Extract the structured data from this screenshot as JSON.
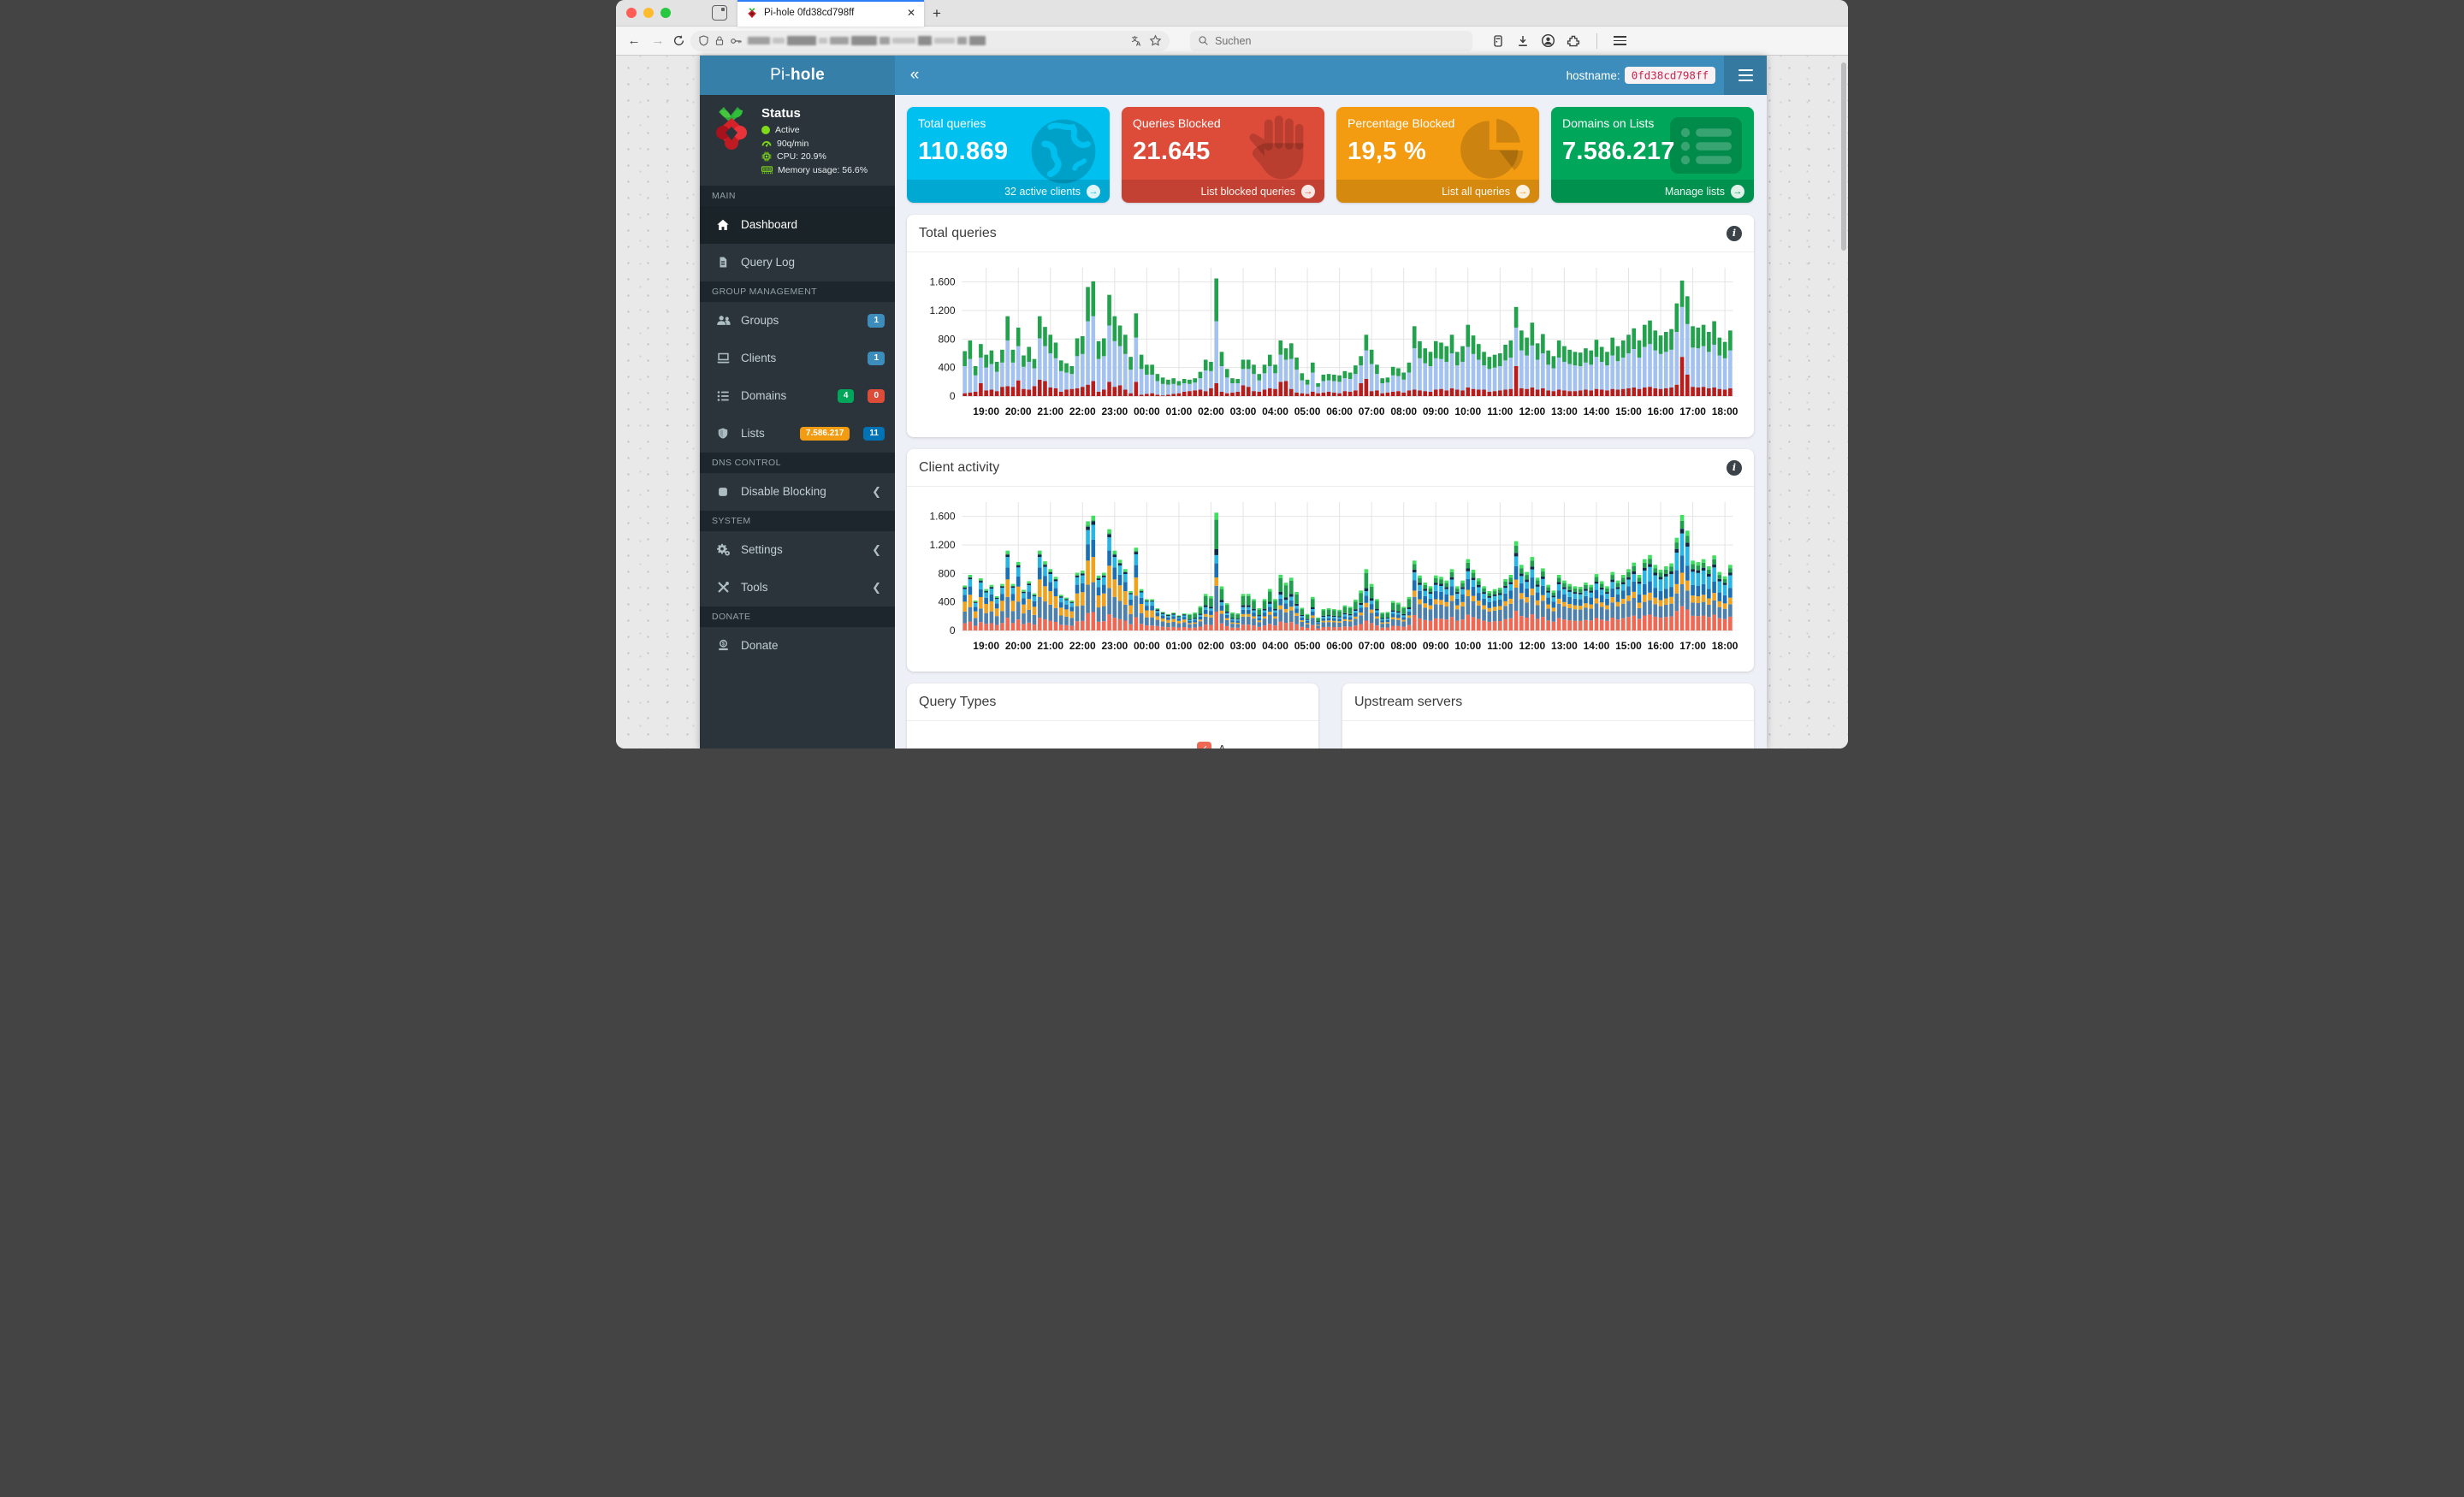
{
  "browser": {
    "tab_title": "Pi-hole 0fd38cd798ff",
    "new_tab_label": "+",
    "close_label": "✕",
    "search_placeholder": "Suchen"
  },
  "header": {
    "brand_pre": "Pi-",
    "brand_bold": "hole",
    "collapse_glyph": "«",
    "hostname_label": "hostname:",
    "hostname_value": "0fd38cd798ff"
  },
  "status": {
    "title": "Status",
    "rows": [
      {
        "label": "Active"
      },
      {
        "label": "90q/min"
      },
      {
        "label": "CPU: 20.9%"
      },
      {
        "label": "Memory usage: 56.6%"
      }
    ]
  },
  "sidebar": {
    "sections": [
      {
        "label": "MAIN",
        "items": [
          {
            "label": "Dashboard"
          },
          {
            "label": "Query Log"
          }
        ]
      },
      {
        "label": "GROUP MANAGEMENT",
        "items": [
          {
            "label": "Groups",
            "badges": [
              {
                "text": "1",
                "color": "#3c8dbc"
              }
            ]
          },
          {
            "label": "Clients",
            "badges": [
              {
                "text": "1",
                "color": "#3c8dbc"
              }
            ]
          },
          {
            "label": "Domains",
            "badges": [
              {
                "text": "4",
                "color": "#00a65a"
              },
              {
                "text": "0",
                "color": "#dd4b39"
              }
            ]
          },
          {
            "label": "Lists",
            "badges": [
              {
                "text": "7.586.217",
                "color": "#f39c12"
              },
              {
                "text": "11",
                "color": "#0073b7"
              }
            ]
          }
        ]
      },
      {
        "label": "DNS CONTROL",
        "items": [
          {
            "label": "Disable Blocking",
            "chevron": "❮"
          }
        ]
      },
      {
        "label": "SYSTEM",
        "items": [
          {
            "label": "Settings",
            "chevron": "❮"
          },
          {
            "label": "Tools",
            "chevron": "❮"
          }
        ]
      },
      {
        "label": "DONATE",
        "items": [
          {
            "label": "Donate"
          }
        ]
      }
    ]
  },
  "cards": [
    {
      "title": "Total queries",
      "value": "110.869",
      "footer": "32 active clients",
      "color": "#00c0ef"
    },
    {
      "title": "Queries Blocked",
      "value": "21.645",
      "footer": "List blocked queries",
      "color": "#dd4b39"
    },
    {
      "title": "Percentage Blocked",
      "value": "19,5 %",
      "footer": "List all queries",
      "color": "#f39c12"
    },
    {
      "title": "Domains on Lists",
      "value": "7.586.217",
      "footer": "Manage lists",
      "color": "#00a65a"
    }
  ],
  "panels": {
    "total_queries": {
      "title": "Total queries"
    },
    "client_activity": {
      "title": "Client activity"
    },
    "query_types": {
      "title": "Query Types",
      "legend": [
        {
          "label": "A",
          "color": "#ee6853",
          "checked": true
        }
      ]
    },
    "upstream": {
      "title": "Upstream servers"
    }
  },
  "chart_data": [
    {
      "id": "total_queries",
      "type": "bar",
      "stacked": true,
      "title": "Total queries",
      "x_labels": [
        "19:00",
        "20:00",
        "21:00",
        "22:00",
        "23:00",
        "00:00",
        "01:00",
        "02:00",
        "03:00",
        "04:00",
        "05:00",
        "06:00",
        "07:00",
        "08:00",
        "09:00",
        "10:00",
        "11:00",
        "12:00",
        "13:00",
        "14:00",
        "15:00",
        "16:00",
        "17:00",
        "18:00"
      ],
      "ylim": [
        0,
        1800
      ],
      "yticks": [
        0,
        400,
        800,
        1200,
        1600
      ],
      "ytick_labels": [
        "0",
        "400",
        "800",
        "1.200",
        "1.600"
      ],
      "grid": true,
      "series": [
        {
          "name": "blocked",
          "color": "#b71d1d",
          "values": [
            40,
            50,
            60,
            180,
            80,
            90,
            70,
            130,
            140,
            130,
            220,
            100,
            90,
            140,
            230,
            210,
            120,
            110,
            60,
            90,
            100,
            110,
            130,
            160,
            210,
            60,
            90,
            200,
            130,
            150,
            90,
            40,
            200,
            20,
            30,
            40,
            20,
            10,
            20,
            30,
            40,
            60,
            70,
            80,
            90,
            70,
            110,
            180,
            60,
            40,
            50,
            60,
            150,
            130,
            70,
            60,
            90,
            110,
            100,
            200,
            210,
            100,
            50,
            40,
            30,
            60,
            40,
            50,
            60,
            50,
            40,
            70,
            60,
            80,
            180,
            240,
            70,
            80,
            40,
            50,
            60,
            70,
            50,
            80,
            90,
            80,
            70,
            60,
            90,
            100,
            80,
            110,
            90,
            80,
            120,
            100,
            90,
            90,
            60,
            70,
            80,
            90,
            100,
            420,
            110,
            100,
            120,
            90,
            110,
            80,
            70,
            90,
            80,
            70,
            70,
            80,
            90,
            80,
            100,
            90,
            80,
            100,
            90,
            100,
            110,
            120,
            100,
            120,
            130,
            110,
            100,
            110,
            120,
            160,
            550,
            300,
            130,
            120,
            130,
            110,
            120,
            100,
            90,
            110
          ]
        },
        {
          "name": "cached",
          "color": "#a4c2ef",
          "values": [
            380,
            470,
            230,
            360,
            320,
            360,
            270,
            340,
            640,
            340,
            480,
            310,
            390,
            250,
            580,
            490,
            480,
            420,
            290,
            240,
            210,
            450,
            460,
            890,
            910,
            460,
            470,
            790,
            640,
            550,
            500,
            330,
            620,
            360,
            270,
            260,
            190,
            160,
            140,
            140,
            110,
            120,
            100,
            110,
            160,
            290,
            240,
            870,
            360,
            220,
            130,
            120,
            230,
            250,
            240,
            160,
            230,
            310,
            220,
            380,
            300,
            420,
            320,
            180,
            130,
            270,
            90,
            160,
            160,
            160,
            160,
            180,
            180,
            230,
            250,
            400,
            380,
            230,
            140,
            140,
            230,
            210,
            180,
            250,
            580,
            450,
            390,
            360,
            440,
            420,
            400,
            490,
            340,
            400,
            570,
            490,
            420,
            340,
            320,
            330,
            340,
            410,
            440,
            540,
            530,
            470,
            590,
            420,
            490,
            360,
            320,
            450,
            400,
            380,
            360,
            340,
            380,
            360,
            450,
            390,
            350,
            470,
            400,
            440,
            490,
            540,
            440,
            570,
            600,
            530,
            490,
            510,
            530,
            740,
            700,
            710,
            550,
            550,
            570,
            510,
            600,
            470,
            440,
            530
          ]
        },
        {
          "name": "forwarded",
          "color": "#23a24d",
          "values": [
            210,
            260,
            130,
            190,
            180,
            190,
            140,
            180,
            340,
            180,
            260,
            160,
            210,
            130,
            310,
            270,
            260,
            220,
            150,
            130,
            110,
            250,
            250,
            480,
            490,
            250,
            250,
            430,
            350,
            290,
            270,
            180,
            340,
            200,
            140,
            140,
            100,
            90,
            70,
            80,
            60,
            60,
            60,
            60,
            90,
            150,
            130,
            600,
            200,
            120,
            70,
            60,
            130,
            130,
            130,
            90,
            120,
            160,
            120,
            200,
            160,
            220,
            170,
            100,
            70,
            140,
            50,
            90,
            90,
            90,
            90,
            100,
            90,
            120,
            130,
            220,
            200,
            130,
            70,
            70,
            120,
            110,
            100,
            140,
            310,
            240,
            210,
            200,
            240,
            230,
            220,
            260,
            190,
            220,
            310,
            260,
            220,
            190,
            170,
            180,
            180,
            220,
            240,
            290,
            280,
            250,
            320,
            230,
            270,
            200,
            170,
            240,
            220,
            200,
            190,
            190,
            200,
            200,
            240,
            210,
            190,
            250,
            210,
            240,
            260,
            290,
            240,
            310,
            330,
            280,
            260,
            280,
            290,
            400,
            370,
            390,
            300,
            290,
            300,
            280,
            330,
            250,
            230,
            280
          ]
        }
      ]
    },
    {
      "id": "client_activity",
      "type": "bar",
      "stacked": true,
      "title": "Client activity",
      "x_labels": [
        "19:00",
        "20:00",
        "21:00",
        "22:00",
        "23:00",
        "00:00",
        "01:00",
        "02:00",
        "03:00",
        "04:00",
        "05:00",
        "06:00",
        "07:00",
        "08:00",
        "09:00",
        "10:00",
        "11:00",
        "12:00",
        "13:00",
        "14:00",
        "15:00",
        "16:00",
        "17:00",
        "18:00"
      ],
      "ylim": [
        0,
        1800
      ],
      "yticks": [
        0,
        400,
        800,
        1200,
        1600
      ],
      "ytick_labels": [
        "0",
        "400",
        "800",
        "1.200",
        "1.600"
      ],
      "grid": true,
      "basis": "total_queries",
      "series": [
        {
          "color": "#ee6853",
          "shares": [
            0.16,
            0.16,
            0.16,
            0.16,
            0.16,
            0.16,
            0.2,
            0.16,
            0.16,
            0.16,
            0.16,
            0.16,
            0.16,
            0.16,
            0.22,
            0.22,
            0.22,
            0.22,
            0.22,
            0.22,
            0.22,
            0.21,
            0.21,
            0.21
          ]
        },
        {
          "color": "#4e80ad",
          "shares": [
            0.26,
            0.26,
            0.26,
            0.26,
            0.26,
            0.26,
            0.28,
            0.22,
            0.22,
            0.22,
            0.22,
            0.22,
            0.22,
            0.22,
            0.26,
            0.26,
            0.26,
            0.26,
            0.26,
            0.26,
            0.26,
            0.19,
            0.19,
            0.19
          ]
        },
        {
          "color": "#f0a11d",
          "shares": [
            0.22,
            0.22,
            0.22,
            0.22,
            0.22,
            0.22,
            0.16,
            0.07,
            0.07,
            0.07,
            0.07,
            0.07,
            0.07,
            0.07,
            0.09,
            0.09,
            0.09,
            0.09,
            0.09,
            0.09,
            0.09,
            0.1,
            0.1,
            0.1
          ]
        },
        {
          "color": "#1b6fb5",
          "shares": [
            0.15,
            0.15,
            0.15,
            0.15,
            0.15,
            0.15,
            0.16,
            0.12,
            0.12,
            0.12,
            0.12,
            0.12,
            0.12,
            0.12,
            0.15,
            0.15,
            0.15,
            0.15,
            0.15,
            0.15,
            0.15,
            0.15,
            0.15,
            0.15
          ]
        },
        {
          "color": "#2ab6e4",
          "shares": [
            0.13,
            0.13,
            0.13,
            0.13,
            0.13,
            0.13,
            0.08,
            0.07,
            0.07,
            0.07,
            0.07,
            0.07,
            0.07,
            0.07,
            0.11,
            0.11,
            0.11,
            0.11,
            0.11,
            0.11,
            0.11,
            0.19,
            0.19,
            0.19
          ]
        },
        {
          "color": "#0e2a47",
          "shares": [
            0.03,
            0.03,
            0.03,
            0.03,
            0.03,
            0.03,
            0.06,
            0.05,
            0.05,
            0.05,
            0.05,
            0.05,
            0.05,
            0.05,
            0.04,
            0.04,
            0.04,
            0.04,
            0.04,
            0.04,
            0.04,
            0.04,
            0.04,
            0.04
          ]
        },
        {
          "color": "#1f9e4e",
          "shares": [
            0.01,
            0.01,
            0.01,
            0.01,
            0.01,
            0.01,
            0.02,
            0.25,
            0.25,
            0.25,
            0.25,
            0.25,
            0.25,
            0.25,
            0.08,
            0.08,
            0.08,
            0.08,
            0.08,
            0.08,
            0.08,
            0.07,
            0.07,
            0.07
          ]
        },
        {
          "color": "#3fe05f",
          "shares": [
            0.04,
            0.04,
            0.04,
            0.04,
            0.04,
            0.04,
            0.04,
            0.06,
            0.06,
            0.06,
            0.06,
            0.06,
            0.06,
            0.06,
            0.05,
            0.05,
            0.05,
            0.05,
            0.05,
            0.05,
            0.05,
            0.05,
            0.05,
            0.05
          ]
        }
      ]
    }
  ]
}
